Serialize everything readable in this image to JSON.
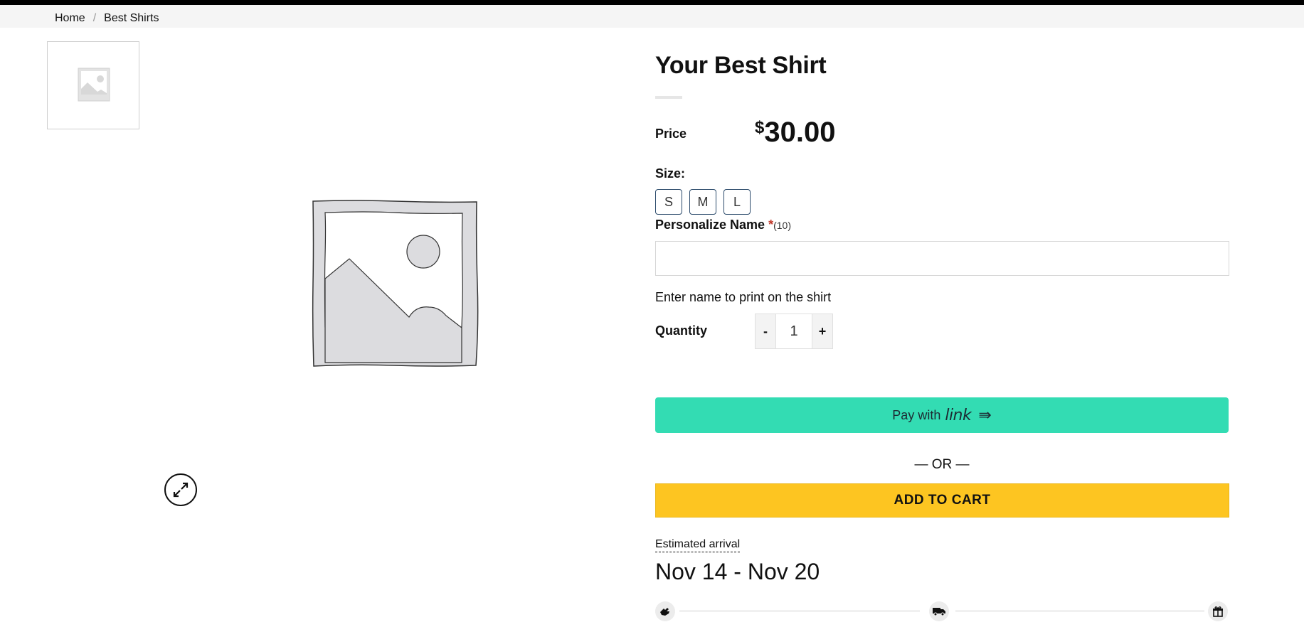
{
  "breadcrumb": {
    "home": "Home",
    "current": "Best Shirts",
    "separator": "/"
  },
  "product": {
    "title": "Your Best Shirt",
    "price_label": "Price",
    "currency_symbol": "$",
    "price": "30.00"
  },
  "size": {
    "label": "Size:",
    "options": [
      "S",
      "M",
      "L"
    ]
  },
  "personalize": {
    "label": "Personalize Name",
    "required_mark": "*",
    "char_limit": "(10)",
    "value": "",
    "helper": "Enter name to print on the shirt"
  },
  "quantity": {
    "label": "Quantity",
    "minus": "-",
    "value": "1",
    "plus": "+"
  },
  "pay_link": {
    "label": "Pay with",
    "brand": "link",
    "arrow": "⇛",
    "color": "#33dcb3"
  },
  "or_divider": "— OR —",
  "add_to_cart": {
    "label": "ADD TO CART",
    "color": "#fdc521"
  },
  "estimate": {
    "label": "Estimated arrival",
    "dates": "Nov 14 - Nov 20"
  },
  "timeline": {
    "icons": [
      "hand-icon",
      "delivery-truck-icon",
      "gift-icon"
    ]
  },
  "icons": {
    "zoom": "expand-arrows-icon",
    "placeholder": "image-placeholder-icon"
  }
}
